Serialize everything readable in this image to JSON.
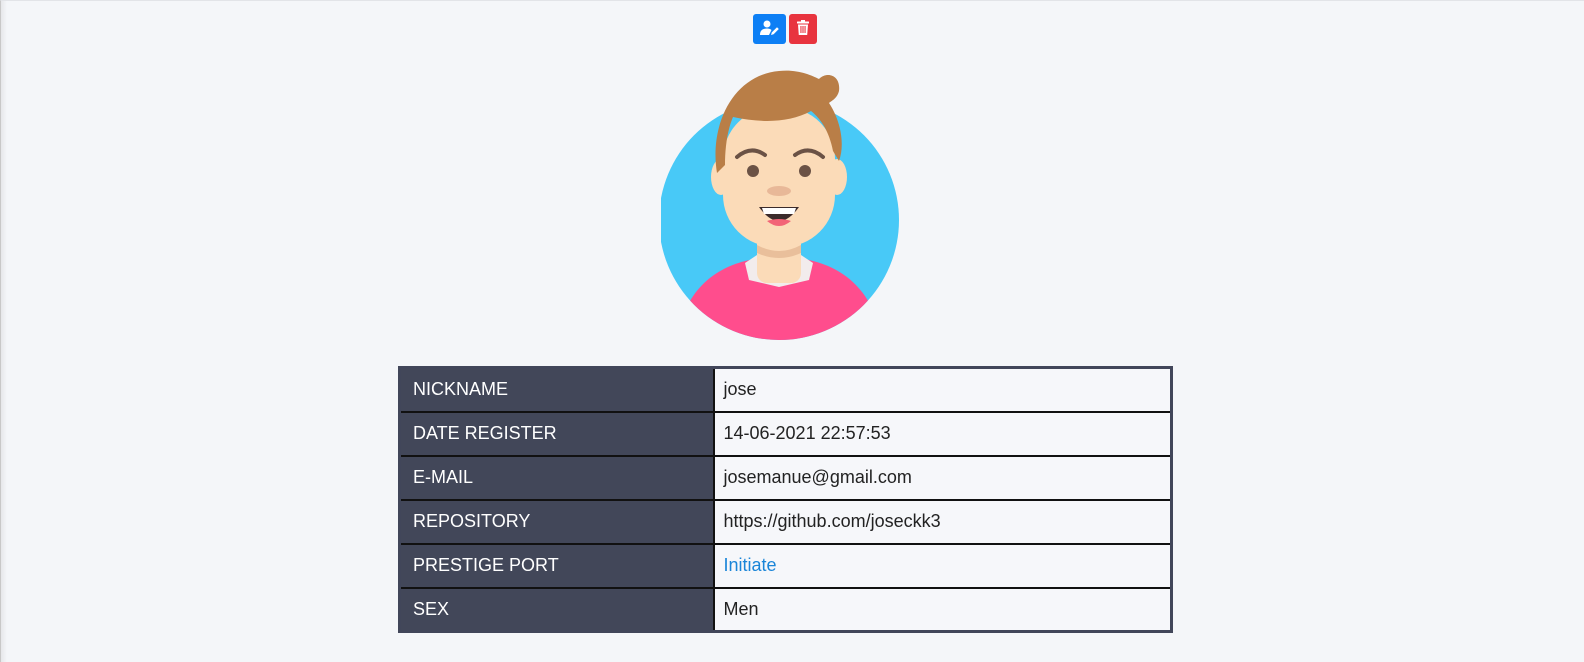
{
  "actions": {
    "edit_icon": "user-edit-icon",
    "delete_icon": "trash-icon",
    "edit_color": "#0d7ff5",
    "delete_color": "#e8343f"
  },
  "avatar": {
    "icon": "cartoon-avatar",
    "background_color": "#48c9f7",
    "shirt_color": "#ff4d8d"
  },
  "profile": {
    "nickname_label": "NICKNAME",
    "nickname": "jose",
    "date_label": "DATE REGISTER",
    "date": "14-06-2021 22:57:53",
    "email_label": "E-MAIL",
    "email": "josemanue@gmail.com",
    "repo_label": "REPOSITORY",
    "repo": "https://github.com/joseckk3",
    "prestige_label": "PRESTIGE PORT",
    "prestige": "Initiate",
    "sex_label": "SEX",
    "sex": "Men"
  }
}
